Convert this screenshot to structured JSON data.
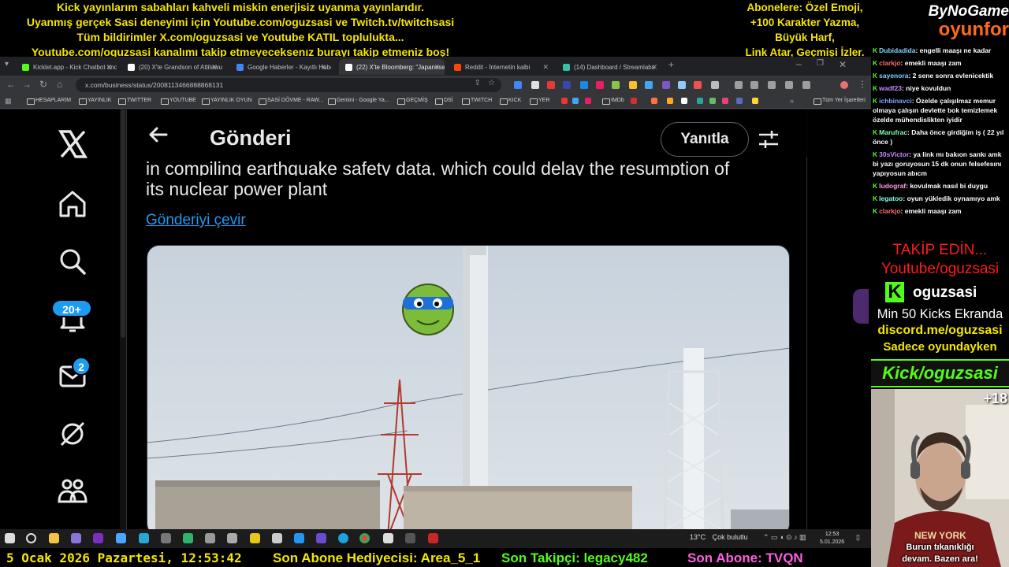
{
  "overlay": {
    "top_left_lines": [
      "Kick yayınlarım sabahları kahveli miskin enerjisiz uyanma yayınlarıdır.",
      "Uyanmış gerçek Sasi deneyimi için Youtube.com/oguzsasi ve Twitch.tv/twitchsasi",
      "Tüm bildirimler X.com/oguzsasi ve Youtube KATIL topluluktа...",
      "Youtube.com/oguzsasi kanalımı takip etmeyeceksenız burayı takip etmeniz boş!"
    ],
    "top_right_lines": [
      "Abonelere: Özel Emoji,",
      "+100 Karakter Yazma,",
      "Büyük Harf,",
      "Link Atar, Geçmişi İzler."
    ],
    "logo_line1": "ByNoGame",
    "logo_line2": "oyunfor"
  },
  "browser": {
    "tabs": [
      {
        "label": "Kicklet.app - Kick Chatbot and",
        "color": "#53fc18"
      },
      {
        "label": "(20) X'te Grandson of Attilawu",
        "color": "#ffffff"
      },
      {
        "label": "Google Haberler - Kayıtlı Habe",
        "color": "#4285f4"
      },
      {
        "label": "(22) X'te Bloomberg: \"Japanese",
        "color": "#ffffff"
      },
      {
        "label": "Reddit - İnternetin kalbi",
        "color": "#ff4500"
      },
      {
        "label": "(14) Dashboard / Streamlabs",
        "color": "#31c3a2"
      }
    ],
    "new_tab": "+",
    "url": "x.com/business/status/2008113466888868131",
    "bookmarks": [
      "HESAPLARIM",
      "YAYINLIK",
      "TWITTER",
      "YOUTUBE",
      "YAYINLIK OYUN",
      "SASİ DÖVME - RAW...",
      "Gemini - Google Ya...",
      "GEÇMİŞ",
      "DSİ",
      "TWITCH",
      "KICK",
      "YER",
      "IMDb"
    ],
    "all_bookmarks": "Tüm Yer İşaretleri"
  },
  "x_page": {
    "notifications_badge": "20+",
    "messages_badge": "2",
    "title": "Gönderi",
    "reply_label": "Yanıtla",
    "tweet_partial": "in compiling earthquake safety data, which could delay the resumption of",
    "tweet_text": "its nuclear power plant",
    "translate_label": "Gönderiyi çevir"
  },
  "taskbar": {
    "weather_temp": "13°C",
    "weather_desc": "Çok bulutlu",
    "time": "12:53",
    "date": "5.01.2026"
  },
  "bottom_bar": {
    "datetime": "5 Ocak 2026 Pazartesi, 12:53:42",
    "gift_sub": "Son Abone Hediyecisi: Area_5_1",
    "follower": "Son Takipçi: legacy482",
    "subscriber": "Son Abone: TVQN"
  },
  "chat": [
    {
      "user": "Dubidadida",
      "text": ": engelli maaşı ne kadar",
      "color": "#7fd3ff"
    },
    {
      "user": "clarkjo",
      "text": ": emekli maaşı zam",
      "color": "#ff6b6b"
    },
    {
      "user": "sayenora",
      "text": ": 2 sene sonra evlenicektik",
      "color": "#7fd3ff"
    },
    {
      "user": "wadf23",
      "text": ": niye kovuldun",
      "color": "#c58bff"
    },
    {
      "user": "ichbinavci",
      "text": ": Özelde çalışılmaz memur olmaya çalışın devlette bok temizlemek özelde mühendislikten iyidir",
      "color": "#7fa8ff"
    },
    {
      "user": "Marufrac",
      "text": ": Daha önce girdiğim iş ( 22 yıl önce )",
      "color": "#7fffb0"
    },
    {
      "user": "30sVictor",
      "text": ": ya link mı bakıon sankı amk bi yazı goruyosun 15 dk onun felsefesını yapıyosun abıcm",
      "color": "#c58bff"
    },
    {
      "user": "ludograf",
      "text": ": kovulmak nasıl bi duygu",
      "color": "#ff9ee6"
    },
    {
      "user": "legatoo",
      "text": ": oyun yükledik oynamıyo amk",
      "color": "#7fffe0"
    },
    {
      "user": "clarkjo",
      "text": ": emekli maaşı zam",
      "color": "#ff6b6b"
    }
  ],
  "promo": {
    "follow": "TAKİP EDİN...",
    "youtube": "Youtube/oguzsasi",
    "kick_name": "oguzsasi",
    "min_kicks": "Min 50 Kicks Ekranda",
    "discord": "discord.me/oguzsasi",
    "only_game": "Sadece oyundayken",
    "kick_handle": "Kick/oguzsasi"
  },
  "cam": {
    "age": "+18",
    "caption_1": "Burun tıkanıklığı",
    "caption_2": "devam. Bazen ara!"
  }
}
